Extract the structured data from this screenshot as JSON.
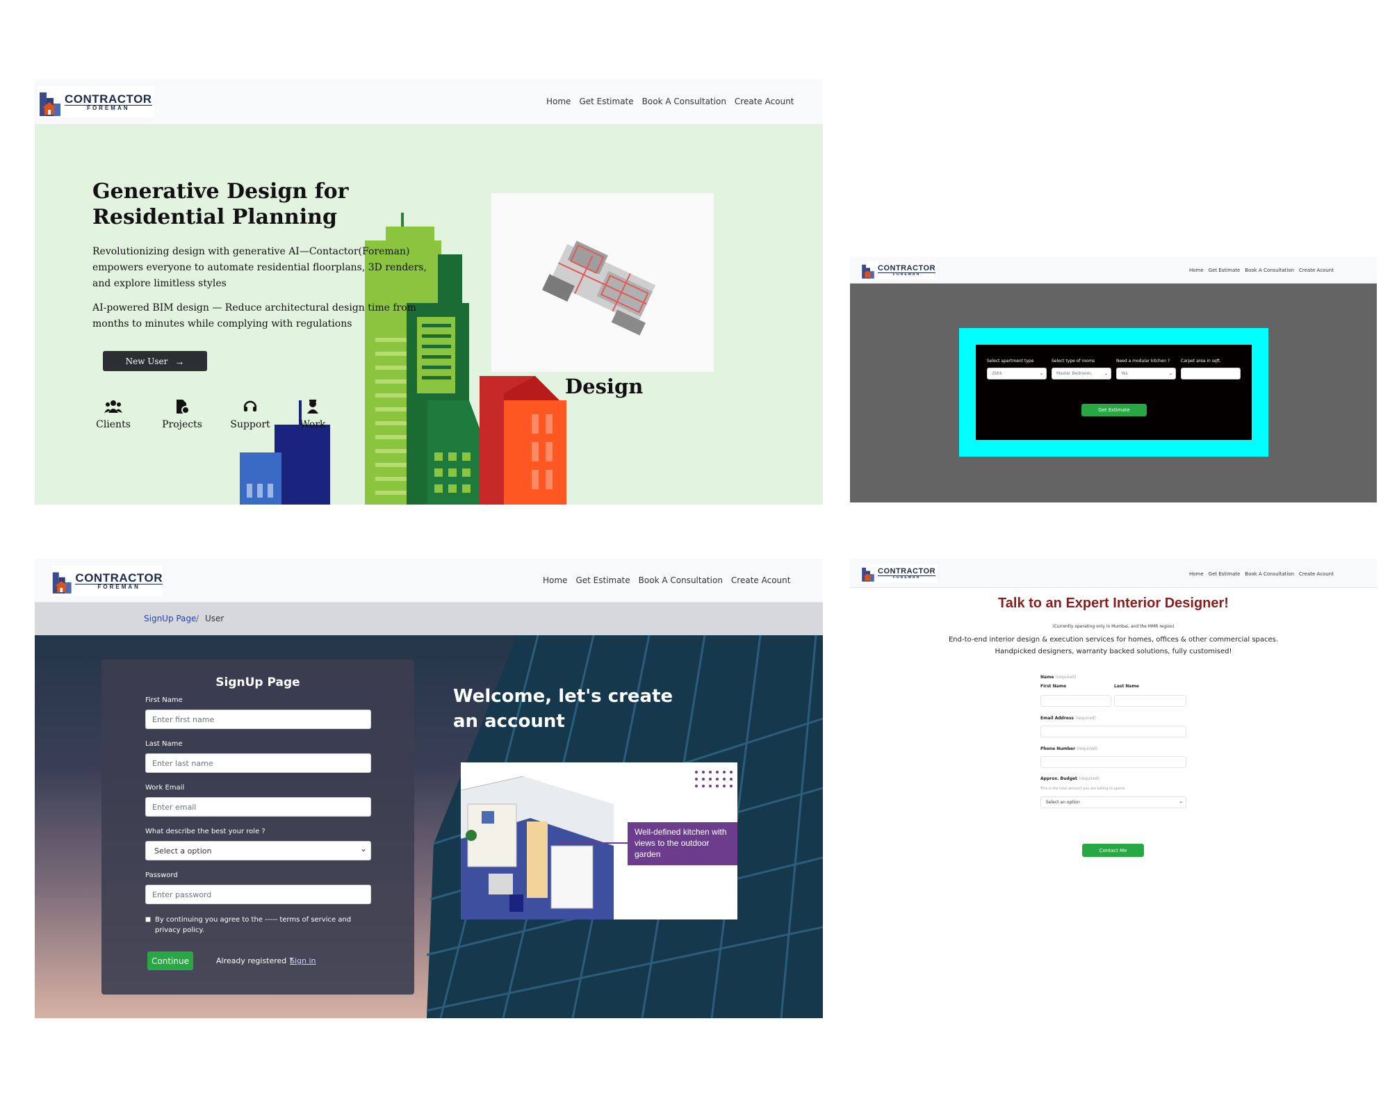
{
  "brand": {
    "line1": "CONTRACTOR",
    "line2": "FOREMAN"
  },
  "nav": {
    "home": "Home",
    "estimate": "Get Estimate",
    "consult": "Book A Consultation",
    "account": "Create Acount"
  },
  "home": {
    "title_line1": "Generative Design for",
    "title_line2": "Residential Planning",
    "para1": "Revolutionizing design with generative AI—Contactor(Foreman) empowers everyone to automate residential floorplans, 3D renders, and explore limitless styles",
    "para2": "AI-powered BIM design — Reduce architectural design time from months to minutes while complying with regulations",
    "new_user": "New User",
    "design_caption": "Design",
    "features": [
      "Clients",
      "Projects",
      "Support",
      "Work"
    ]
  },
  "estimate": {
    "labels": [
      "Select apartment type",
      "Select type of rooms",
      "Need a modular kitchen ?",
      "Carpet area in sqft."
    ],
    "values": [
      "2bhk",
      "Master Bedroom,",
      "Yes",
      ""
    ],
    "button": "Get Estimate"
  },
  "signup": {
    "breadcrumb_link": "SignUp Page",
    "breadcrumb_sep": "/",
    "breadcrumb_current": "User",
    "form_title": "SignUp Page",
    "first_name_label": "First Name",
    "first_name_placeholder": "Enter first name",
    "last_name_label": "Last Name",
    "last_name_placeholder": "Enter last name",
    "email_label": "Work Email",
    "email_placeholder": "Enter email",
    "role_label": "What describe the best your role ?",
    "role_value": "Select a option",
    "password_label": "Password",
    "password_placeholder": "Enter password",
    "terms": "By continuing you agree to the ----- terms of service and privacy policy.",
    "continue": "Continue",
    "already": "Already registered ?",
    "signin": "Sign in",
    "welcome": "Welcome, let's create an account",
    "promo": "Well-defined kitchen with views to the outdoor garden"
  },
  "consult": {
    "title": "Talk to an Expert Interior Designer!",
    "note": "(Currently operating only in Mumbai, and the MMR region)",
    "desc1": "End-to-end interior design & execution services for homes, offices & other commercial spaces.",
    "desc2": "Handpicked designers, warranty backed solutions, fully customised!",
    "name_label": "Name",
    "required": "(required)",
    "first_name": "First Name",
    "last_name": "Last Name",
    "email_label": "Email Address",
    "phone_label": "Phone Number",
    "budget_label": "Approx. Budget",
    "budget_hint": "This is the total amount you are willing to spend",
    "budget_value": "Select an option",
    "button": "Contact Me"
  },
  "colors": {
    "nav_bg": "#f8f9fa",
    "hero_bg": "#e2f3df",
    "estimate_bg": "#646464",
    "estimate_frame": "#00ffff",
    "signup_accent": "#28a745",
    "consult_title": "#8b1c1c",
    "promo_purple": "#6b3d8c"
  }
}
